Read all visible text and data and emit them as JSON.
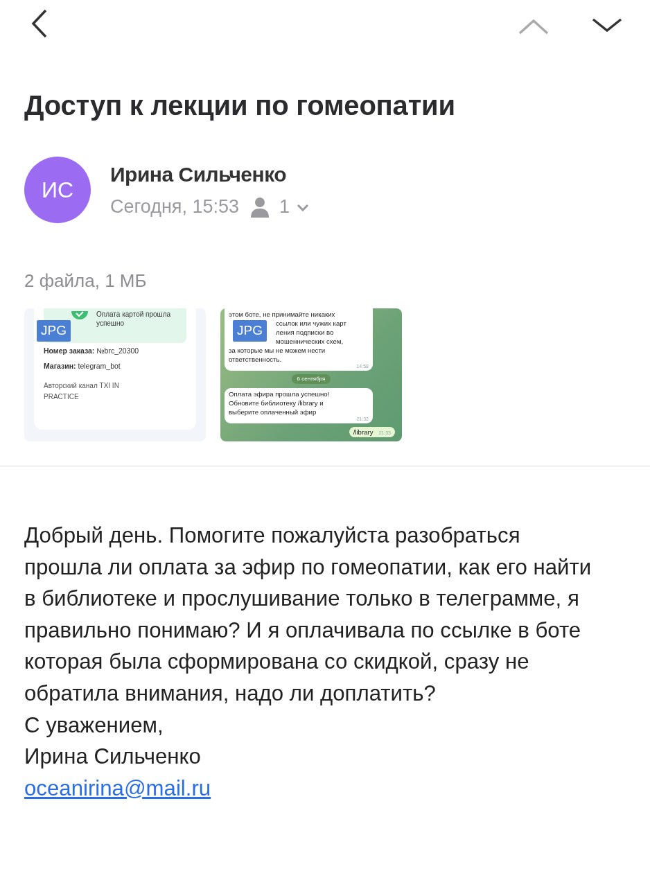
{
  "navigation": {
    "previous_disabled": true,
    "next_disabled": false
  },
  "subject": "Доступ к лекции по гомеопатии",
  "sender": {
    "initials": "ИС",
    "color": "#9b6bf2",
    "name": "Ирина Сильченко",
    "date": "Сегодня, 15:53",
    "recipients_count": "1",
    "expanded": false
  },
  "attachments": {
    "summary": "2 файла, 1 МБ",
    "files": [
      {
        "kind": "receipt",
        "type": "JPG",
        "banner": [
          "Оплата картой прошла",
          "успешно"
        ],
        "lines": [
          "**Номер заказа:** №brc_20300",
          "**Магазин:** telegram_bot"
        ],
        "footer": "Авторский канал TXI IN PRACTICE"
      },
      {
        "kind": "chat",
        "type": "JPG",
        "messages": [
          {
            "lines": [
              {
                "text": "этом боте, не принимайте никаких"
              },
              {
                "text": "ссылок или чужих карт",
                "covered": true
              },
              {
                "text": "ления подписки во",
                "covered": true
              },
              {
                "text": "мошеннических схем,",
                "covered": true
              },
              {
                "text": "за которые мы не можем нести"
              },
              {
                "text": "ответственность."
              }
            ],
            "time": "14:58",
            "outgoing": false
          },
          {
            "date": "6 сентября"
          },
          {
            "lines": [
              {
                "text": "Оплата эфира прошла успешно!"
              },
              {
                "text": "Обновите библиотеку /library и"
              },
              {
                "text": "выберите оплаченный эфир"
              }
            ],
            "time": "21:32",
            "outgoing": false
          },
          {
            "lines": [
              {
                "text": "/library"
              }
            ],
            "time": "21:33",
            "outgoing": true
          }
        ]
      }
    ]
  },
  "body": {
    "paragraph": "Добрый день. Помогите пожалуйста разобраться прошла ли оплата за эфир по гомеопатии,  как его найти в библиотеке и прослушивание только в телеграмме, я правильно понимаю? И я оплачивала по ссылке в боте которая была сформирована со скидкой, сразу не обратила внимания, надо ли доплатить?",
    "closing": "С уважением,",
    "signature": "Ирина Сильченко",
    "email": "oceanirina@mail.ru"
  }
}
